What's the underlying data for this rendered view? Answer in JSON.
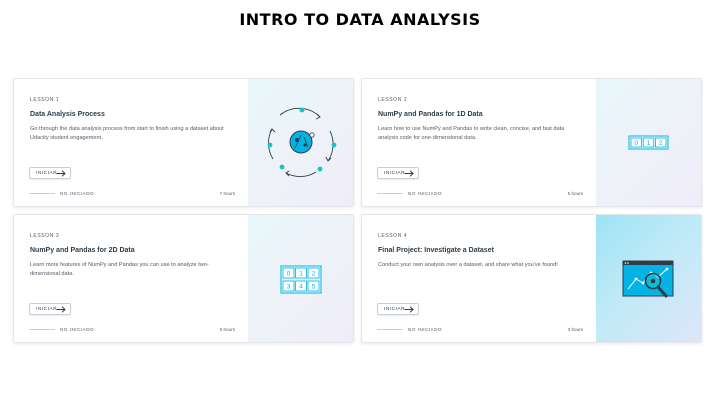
{
  "page": {
    "title": "INTRO TO DATA ANALYSIS"
  },
  "lessons": [
    {
      "number": "LESSON 1",
      "title": "Data Analysis Process",
      "description": "Go through the data analysis process from start to finish using a dataset about Udacity student engagement.",
      "button": "INICIAR",
      "status": "NO INICIADO",
      "hours": "7 hours",
      "icon": "data-cycle-icon"
    },
    {
      "number": "LESSON 2",
      "title": "NumPy and Pandas for 1D Data",
      "description": "Learn how to use NumPy and Pandas to write clean, concise, and fast data analysis code for one-dimensional data.",
      "button": "INICIAR",
      "status": "NO INICIADO",
      "hours": "5 hours",
      "icon": "array-1d-icon",
      "array": [
        "0",
        "1",
        "2"
      ]
    },
    {
      "number": "LESSON 3",
      "title": "NumPy and Pandas for 2D Data",
      "description": "Learn more features of NumPy and Pandas you can use to analyze two-dimensional data.",
      "button": "INICIAR",
      "status": "NO INICIADO",
      "hours": "5 hours",
      "icon": "array-2d-icon",
      "array": [
        "0",
        "1",
        "2",
        "3",
        "4",
        "5"
      ]
    },
    {
      "number": "LESSON 4",
      "title": "Final Project: Investigate a Dataset",
      "description": "Conduct your own analysis over a dataset, and share what you've found!",
      "button": "INICIAR",
      "status": "NO INICIADO",
      "hours": "3 hours",
      "icon": "chart-magnifier-icon"
    }
  ],
  "colors": {
    "accent": "#02b3e4",
    "teal": "#15c5c5",
    "text": "#2e3d49",
    "muted": "#525c65"
  }
}
